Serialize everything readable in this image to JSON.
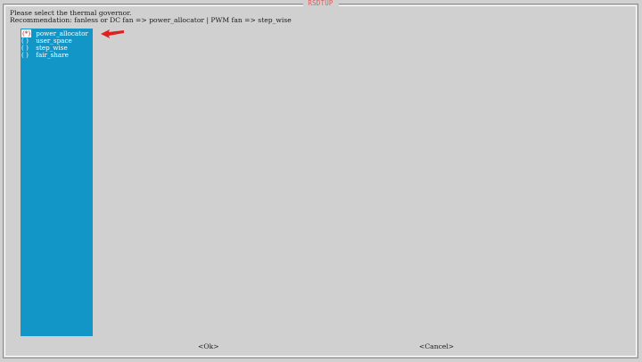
{
  "dialog": {
    "title": "RSDTUP",
    "message_line1": "Please select the thermal governor.",
    "message_line2": "Recommendation: fanless or DC fan => power_allocator | PWM fan => step_wise"
  },
  "options": [
    {
      "marker": "(*)",
      "label": "power_allocator",
      "selected": true
    },
    {
      "marker": "( )",
      "label": "user_space",
      "selected": false
    },
    {
      "marker": "( )",
      "label": "step_wise",
      "selected": false
    },
    {
      "marker": "( )",
      "label": "fair_share",
      "selected": false
    }
  ],
  "buttons": {
    "ok": "<Ok>",
    "cancel": "<Cancel>"
  },
  "colors": {
    "background": "#d0d0d0",
    "list_background": "#1296c8",
    "title": "#e05a5a",
    "annotation_arrow": "#e02020"
  }
}
